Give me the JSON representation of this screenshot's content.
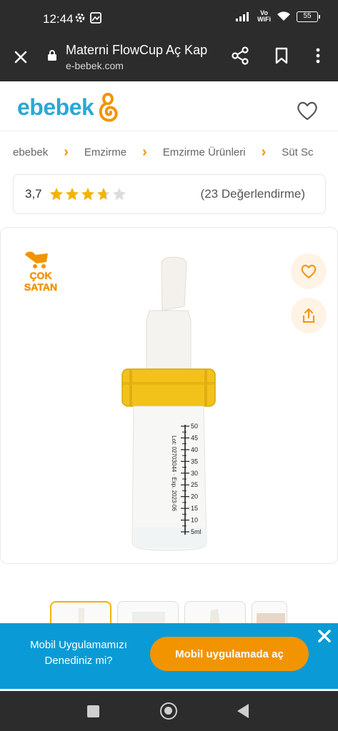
{
  "status_bar": {
    "time": "12:44",
    "network": "Vo\nWiFi",
    "battery": "55"
  },
  "browser": {
    "title": "Materni FlowCup Aç Kap",
    "url": "e-bebek.com"
  },
  "site": {
    "logo_text": "ebebek",
    "brand_color": "#2aa8d6",
    "accent_color": "#f29400"
  },
  "breadcrumb": [
    "ebebek",
    "Emzirme",
    "Emzirme Ürünleri",
    "Süt Sc"
  ],
  "rating": {
    "value": "3,7",
    "stars_filled": 3.7,
    "stars_total": 5,
    "count_text": "(23 Değerlendirme)"
  },
  "product": {
    "badge_line1": "ÇOK",
    "badge_line2": "SATAN",
    "scale_labels": [
      "50",
      "45",
      "40",
      "35",
      "30",
      "25",
      "20",
      "15",
      "10",
      "5ml"
    ],
    "lot_text": "Lot: 02703044 · Exp. 2023-06"
  },
  "app_banner": {
    "text_line1": "Mobil Uygulamamızı",
    "text_line2": "Denediniz mi?",
    "cta_label": "Mobil uygulamada aç"
  }
}
